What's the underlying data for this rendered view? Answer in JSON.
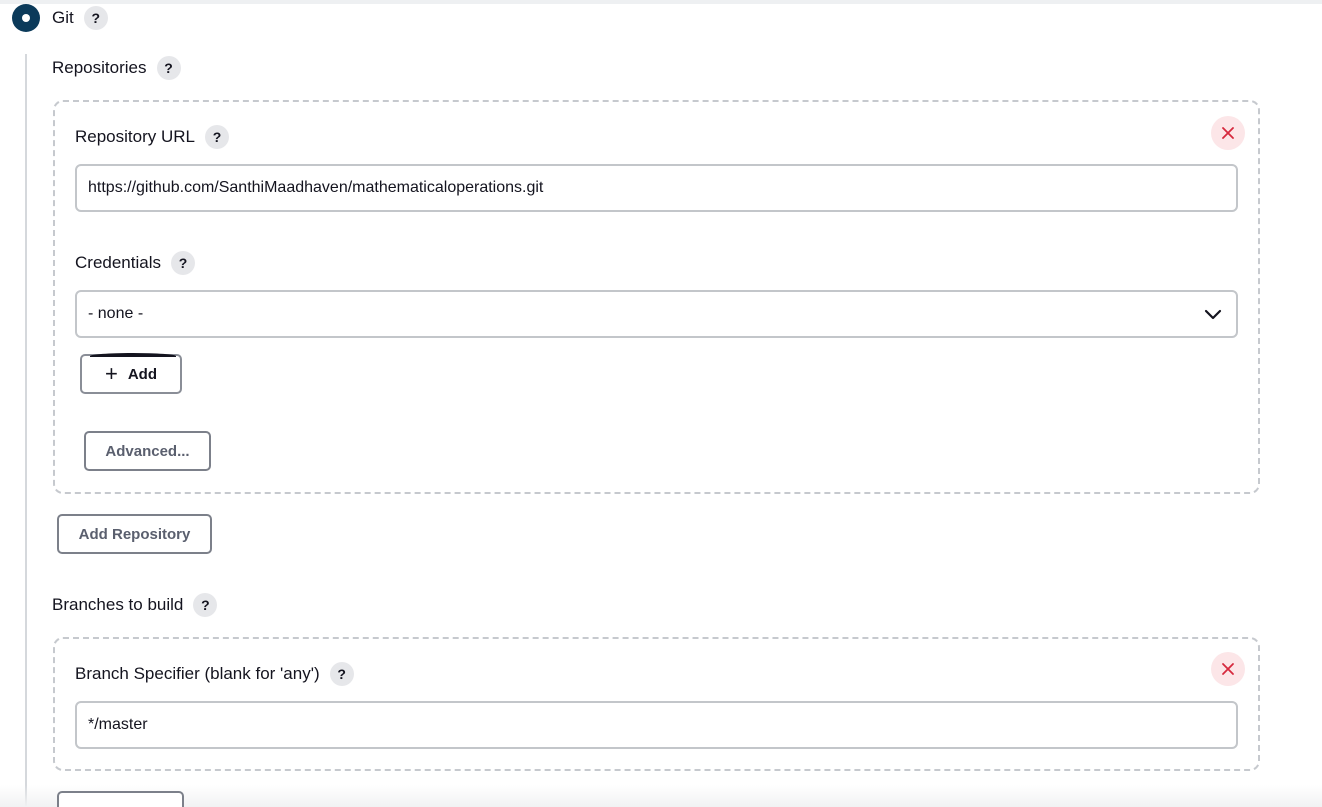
{
  "scm": {
    "option_label": "Git",
    "help_symbol": "?"
  },
  "repositories": {
    "label": "Repositories",
    "repository_url": {
      "label": "Repository URL",
      "value": "https://github.com/SanthiMaadhaven/mathematicaloperations.git"
    },
    "credentials": {
      "label": "Credentials",
      "selected": "- none -",
      "add_button": "Add",
      "add_icon": "plus-icon"
    },
    "advanced_button": "Advanced...",
    "add_repository_button": "Add Repository",
    "delete_icon": "close-icon"
  },
  "branches": {
    "label": "Branches to build",
    "branch_specifier": {
      "label": "Branch Specifier (blank for 'any')",
      "value": "*/master"
    },
    "delete_icon": "close-icon"
  },
  "colors": {
    "radio_selected": "#0b3a5a",
    "delete_icon": "#d6293e",
    "delete_bg": "#fce6e8"
  }
}
